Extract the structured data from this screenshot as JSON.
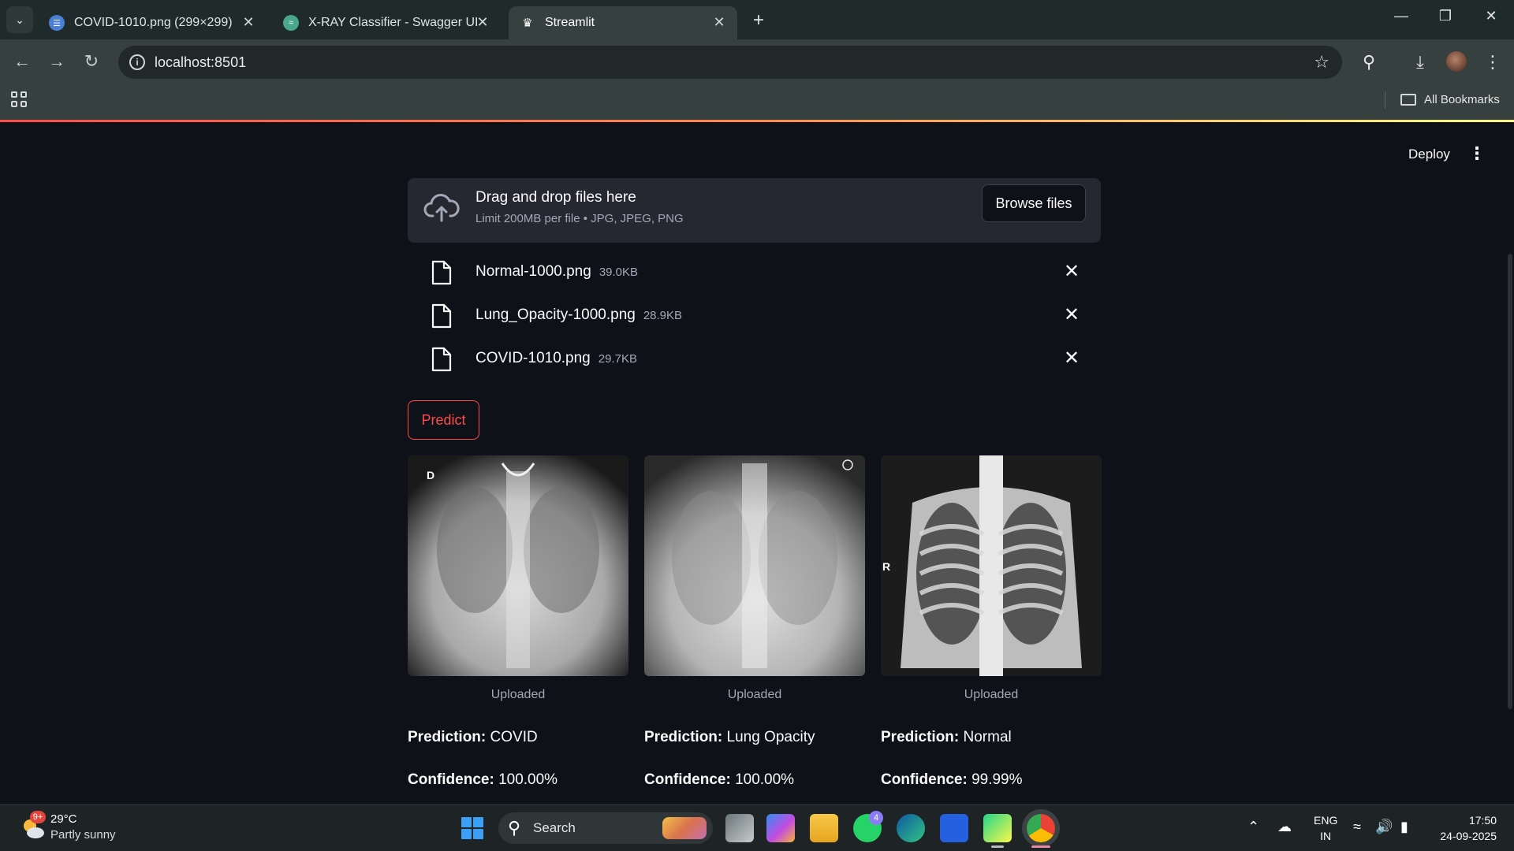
{
  "browser": {
    "tabs": [
      {
        "title": "COVID-1010.png (299×299)",
        "favicon": "image-viewer-icon"
      },
      {
        "title": "X-RAY Classifier - Swagger UI",
        "favicon": "swagger-icon"
      },
      {
        "title": "Streamlit",
        "favicon": "streamlit-crown-icon"
      }
    ],
    "url": "localhost:8501",
    "bookmarks_label": "All Bookmarks",
    "accent_color": "#35403f"
  },
  "app": {
    "deploy_label": "Deploy",
    "uploader": {
      "title": "Drag and drop files here",
      "subtitle": "Limit 200MB per file • JPG, JPEG, PNG",
      "browse_label": "Browse files"
    },
    "files": [
      {
        "name": "Normal-1000.png",
        "size": "39.0KB"
      },
      {
        "name": "Lung_Opacity-1000.png",
        "size": "28.9KB"
      },
      {
        "name": "COVID-1010.png",
        "size": "29.7KB"
      }
    ],
    "predict_label": "Predict",
    "results": [
      {
        "caption": "Uploaded",
        "prediction_label": "Prediction:",
        "prediction": "COVID",
        "confidence_label": "Confidence:",
        "confidence": "100.00%",
        "marker": "D"
      },
      {
        "caption": "Uploaded",
        "prediction_label": "Prediction:",
        "prediction": "Lung Opacity",
        "confidence_label": "Confidence:",
        "confidence": "100.00%",
        "marker": ""
      },
      {
        "caption": "Uploaded",
        "prediction_label": "Prediction:",
        "prediction": "Normal",
        "confidence_label": "Confidence:",
        "confidence": "99.99%",
        "marker": "R"
      }
    ],
    "primary_color": "#ff4b4b"
  },
  "taskbar": {
    "weather": {
      "temp": "29°C",
      "condition": "Partly sunny",
      "badge": "9+"
    },
    "search_label": "Search",
    "whatsapp_badge": "4",
    "lang_line1": "ENG",
    "lang_line2": "IN",
    "time": "17:50",
    "date": "24-09-2025"
  }
}
